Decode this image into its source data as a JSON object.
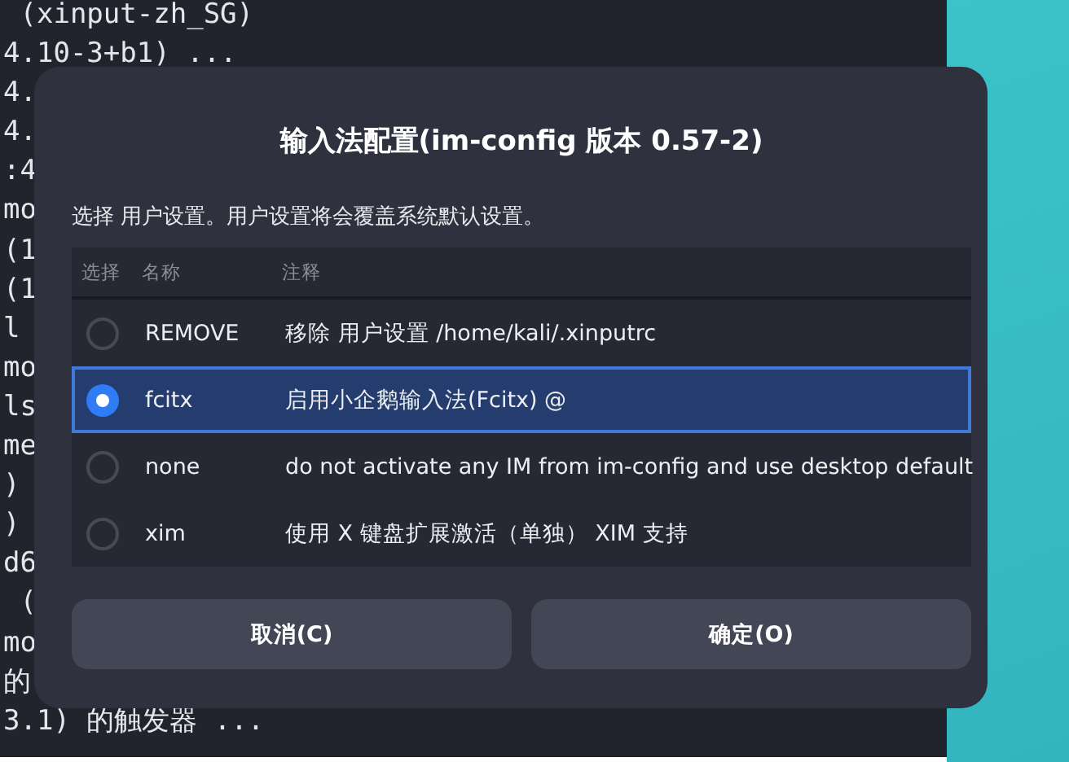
{
  "terminal": {
    "lines": [
      " (xinput-zh_SG)",
      "4.10-3+b1) ...",
      "4.",
      "4.",
      ":4",
      "mo",
      "(1",
      "(1",
      "l",
      "mo",
      "ls",
      "me",
      ")",
      ")",
      "d6",
      " (",
      "mo",
      "的",
      "3.1) 的触发器 ..."
    ]
  },
  "dialog": {
    "title": "输入法配置(im-config 版本 0.57-2)",
    "description": "选择 用户设置。用户设置将会覆盖系统默认设置。",
    "table": {
      "columns": [
        "选择",
        "名称",
        "注释"
      ],
      "rows": [
        {
          "name": "REMOVE",
          "comment": "移除 用户设置 /home/kali/.xinputrc",
          "selected": false
        },
        {
          "name": "fcitx",
          "comment": "启用小企鹅输入法(Fcitx) @",
          "selected": true
        },
        {
          "name": "none",
          "comment": "do not activate any IM from im-config and use desktop default",
          "selected": false
        },
        {
          "name": "xim",
          "comment": "使用 X 键盘扩展激活（单独） XIM 支持",
          "selected": false
        }
      ]
    },
    "buttons": [
      {
        "label": "取消(C)"
      },
      {
        "label": "确定(O)"
      }
    ]
  }
}
